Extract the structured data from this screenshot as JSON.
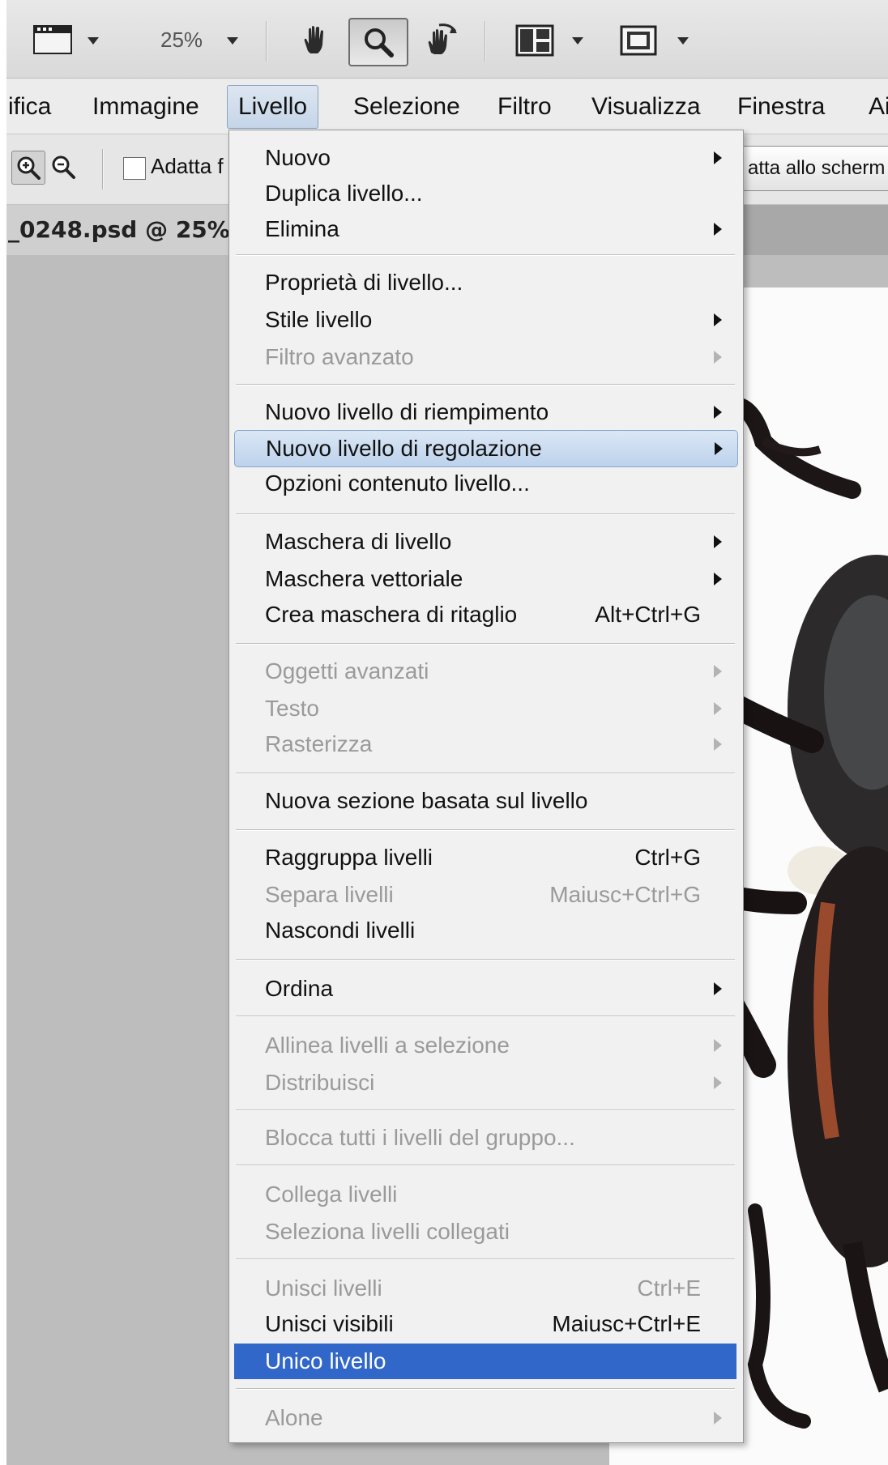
{
  "toolbar": {
    "zoom": "25%"
  },
  "menubar": {
    "items": [
      "ifica",
      "Immagine",
      "Livello",
      "Selezione",
      "Filtro",
      "Visualizza",
      "Finestra",
      "Ai"
    ]
  },
  "options": {
    "adatta_label": "Adatta f",
    "fit_screen_label": "atta allo scherm"
  },
  "document": {
    "tab_title": "_0248.psd @ 25%"
  },
  "menu": {
    "items": [
      {
        "label": "Nuovo",
        "submenu": true,
        "disabled": false
      },
      {
        "label": "Duplica livello...",
        "disabled": false
      },
      {
        "label": "Elimina",
        "submenu": true,
        "disabled": false
      },
      {
        "label": "Proprietà di livello...",
        "disabled": false
      },
      {
        "label": "Stile livello",
        "submenu": true,
        "disabled": false
      },
      {
        "label": "Filtro avanzato",
        "submenu": true,
        "disabled": true
      },
      {
        "label": "Nuovo livello di riempimento",
        "submenu": true,
        "disabled": false
      },
      {
        "label": "Nuovo livello di regolazione",
        "submenu": true,
        "disabled": false,
        "state": "hover"
      },
      {
        "label": "Opzioni contenuto livello...",
        "disabled": false
      },
      {
        "label": "Maschera di livello",
        "submenu": true,
        "disabled": false
      },
      {
        "label": "Maschera vettoriale",
        "submenu": true,
        "disabled": false
      },
      {
        "label": "Crea maschera di ritaglio",
        "shortcut": "Alt+Ctrl+G",
        "disabled": false
      },
      {
        "label": "Oggetti avanzati",
        "submenu": true,
        "disabled": true
      },
      {
        "label": "Testo",
        "submenu": true,
        "disabled": true
      },
      {
        "label": "Rasterizza",
        "submenu": true,
        "disabled": true
      },
      {
        "label": "Nuova sezione basata sul livello",
        "disabled": false
      },
      {
        "label": "Raggruppa livelli",
        "shortcut": "Ctrl+G",
        "disabled": false
      },
      {
        "label": "Separa livelli",
        "shortcut": "Maiusc+Ctrl+G",
        "disabled": true
      },
      {
        "label": "Nascondi livelli",
        "disabled": false
      },
      {
        "label": "Ordina",
        "submenu": true,
        "disabled": false
      },
      {
        "label": "Allinea livelli a selezione",
        "submenu": true,
        "disabled": true
      },
      {
        "label": "Distribuisci",
        "submenu": true,
        "disabled": true
      },
      {
        "label": "Blocca tutti i livelli del gruppo...",
        "disabled": true
      },
      {
        "label": "Collega livelli",
        "disabled": true
      },
      {
        "label": "Seleziona livelli collegati",
        "disabled": true
      },
      {
        "label": "Unisci livelli",
        "shortcut": "Ctrl+E",
        "disabled": true
      },
      {
        "label": "Unisci visibili",
        "shortcut": "Maiusc+Ctrl+E",
        "disabled": false
      },
      {
        "label": "Unico livello",
        "disabled": false,
        "state": "selected"
      },
      {
        "label": "Alone",
        "submenu": true,
        "disabled": true
      }
    ]
  }
}
